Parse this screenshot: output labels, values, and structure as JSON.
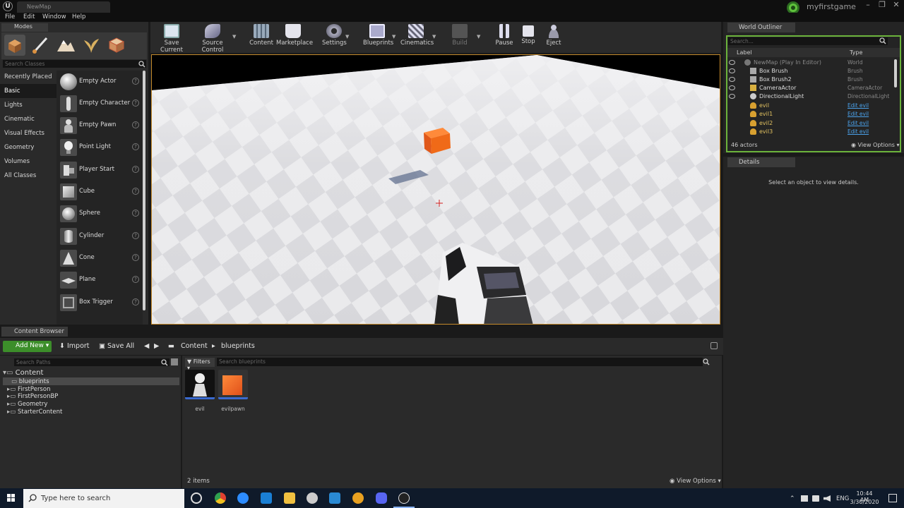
{
  "window": {
    "tab_title": "NewMap",
    "project_name": "myfirstgame",
    "controls": [
      "–",
      "❐",
      "✕"
    ]
  },
  "menu": [
    "File",
    "Edit",
    "Window",
    "Help"
  ],
  "modes": {
    "tab_label": "Modes",
    "search_placeholder": "Search Classes",
    "categories": [
      "Recently Placed",
      "Basic",
      "Lights",
      "Cinematic",
      "Visual Effects",
      "Geometry",
      "Volumes",
      "All Classes"
    ],
    "selected_category": "Basic",
    "items": [
      "Empty Actor",
      "Empty Character",
      "Empty Pawn",
      "Point Light",
      "Player Start",
      "Cube",
      "Sphere",
      "Cylinder",
      "Cone",
      "Plane",
      "Box Trigger"
    ],
    "help_glyph": "?"
  },
  "toolbar": {
    "save_current": "Save Current",
    "source_control": "Source Control",
    "content": "Content",
    "marketplace": "Marketplace",
    "settings": "Settings",
    "blueprints": "Blueprints",
    "cinematics": "Cinematics",
    "build": "Build",
    "pause": "Pause",
    "stop": "Stop",
    "eject": "Eject"
  },
  "outliner": {
    "tab_label": "World Outliner",
    "search_placeholder": "Search...",
    "col_label": "Label",
    "col_type": "Type",
    "rows": [
      {
        "name": "NewMap (Play In Editor)",
        "type": "World"
      },
      {
        "name": "Box Brush",
        "type": "Brush"
      },
      {
        "name": "Box Brush2",
        "type": "Brush"
      },
      {
        "name": "CameraActor",
        "type": "CameraActor"
      },
      {
        "name": "DirectionalLight",
        "type": "DirectionalLight"
      },
      {
        "name": "evil",
        "type": "Edit evil"
      },
      {
        "name": "evil1",
        "type": "Edit evil"
      },
      {
        "name": "evil2",
        "type": "Edit evil"
      },
      {
        "name": "evil3",
        "type": "Edit evil"
      }
    ],
    "actors_count": "46 actors",
    "view_options": "View Options"
  },
  "details": {
    "tab_label": "Details",
    "empty_message": "Select an object to view details."
  },
  "content_browser": {
    "tab_label": "Content Browser",
    "add_new": "Add New",
    "import": "Import",
    "save_all": "Save All",
    "breadcrumb": [
      "Content",
      "blueprints"
    ],
    "search_paths_placeholder": "Search Paths",
    "tree": [
      "Content",
      "blueprints",
      "FirstPerson",
      "FirstPersonBP",
      "Geometry",
      "StarterContent"
    ],
    "filters": "Filters",
    "search_placeholder": "Search blueprints",
    "assets": [
      "evil",
      "evilpawn"
    ],
    "items_count": "2 items",
    "view_options": "View Options"
  },
  "taskbar": {
    "search_text": "Type here to search",
    "language": "ENG",
    "time": "10:44 AM",
    "date": "3/30/2020"
  },
  "colors": {
    "accent_green": "#3c8e2a",
    "viewport_border": "#c58a2b",
    "link_blue": "#4aa0e8",
    "cube_orange": "#f06a18"
  }
}
